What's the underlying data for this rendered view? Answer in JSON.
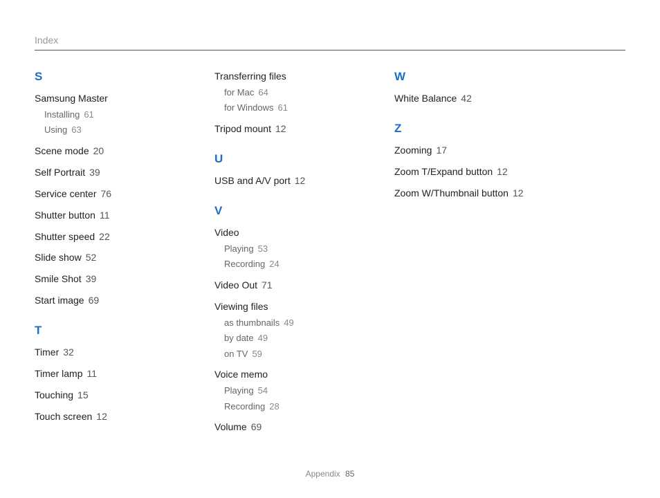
{
  "header": {
    "title": "Index"
  },
  "footer": {
    "section": "Appendix",
    "page": "85"
  },
  "cols": [
    {
      "groups": [
        {
          "letter": "S",
          "entries": [
            {
              "term": "Samsung Master",
              "subs": [
                {
                  "term": "Installing",
                  "page": "61"
                },
                {
                  "term": "Using",
                  "page": "63"
                }
              ]
            },
            {
              "term": "Scene mode",
              "page": "20"
            },
            {
              "term": "Self Portrait",
              "page": "39"
            },
            {
              "term": "Service center",
              "page": "76"
            },
            {
              "term": "Shutter button",
              "page": "11"
            },
            {
              "term": "Shutter speed",
              "page": "22"
            },
            {
              "term": "Slide show",
              "page": "52"
            },
            {
              "term": "Smile Shot",
              "page": "39"
            },
            {
              "term": "Start image",
              "page": "69"
            }
          ]
        },
        {
          "letter": "T",
          "entries": [
            {
              "term": "Timer",
              "page": "32"
            },
            {
              "term": "Timer lamp",
              "page": "11"
            },
            {
              "term": "Touching",
              "page": "15"
            },
            {
              "term": "Touch screen",
              "page": "12"
            }
          ]
        }
      ]
    },
    {
      "groups": [
        {
          "letter": null,
          "entries": [
            {
              "term": "Transferring files",
              "subs": [
                {
                  "term": "for Mac",
                  "page": "64"
                },
                {
                  "term": "for Windows",
                  "page": "61"
                }
              ]
            },
            {
              "term": "Tripod mount",
              "page": "12"
            }
          ]
        },
        {
          "letter": "U",
          "entries": [
            {
              "term": "USB and A/V port",
              "page": "12"
            }
          ]
        },
        {
          "letter": "V",
          "entries": [
            {
              "term": "Video",
              "subs": [
                {
                  "term": "Playing",
                  "page": "53"
                },
                {
                  "term": "Recording",
                  "page": "24"
                }
              ]
            },
            {
              "term": "Video Out",
              "page": "71"
            },
            {
              "term": "Viewing files",
              "subs": [
                {
                  "term": "as thumbnails",
                  "page": "49"
                },
                {
                  "term": "by date",
                  "page": "49"
                },
                {
                  "term": "on TV",
                  "page": "59"
                }
              ]
            },
            {
              "term": "Voice memo",
              "subs": [
                {
                  "term": "Playing",
                  "page": "54"
                },
                {
                  "term": "Recording",
                  "page": "28"
                }
              ]
            },
            {
              "term": "Volume",
              "page": "69"
            }
          ]
        }
      ]
    },
    {
      "groups": [
        {
          "letter": "W",
          "entries": [
            {
              "term": "White Balance",
              "page": "42"
            }
          ]
        },
        {
          "letter": "Z",
          "entries": [
            {
              "term": "Zooming",
              "page": "17"
            },
            {
              "term": "Zoom T/Expand button",
              "page": "12"
            },
            {
              "term": "Zoom W/Thumbnail button",
              "page": "12"
            }
          ]
        }
      ]
    }
  ]
}
